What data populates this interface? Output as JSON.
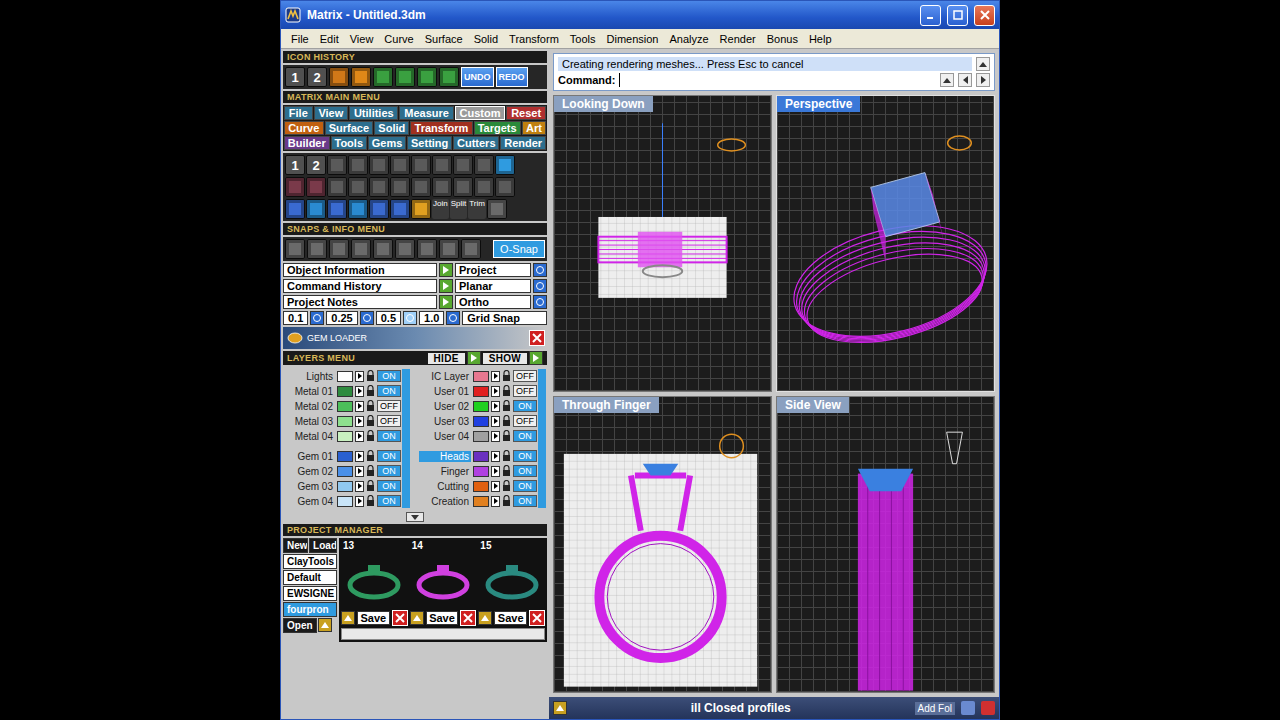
{
  "window": {
    "title": "Matrix - Untitled.3dm"
  },
  "menu_bar": [
    "File",
    "Edit",
    "View",
    "Curve",
    "Surface",
    "Solid",
    "Transform",
    "Tools",
    "Dimension",
    "Analyze",
    "Render",
    "Bonus",
    "Help"
  ],
  "icon_history": {
    "title": "ICON HISTORY",
    "numbers": [
      "1",
      "2"
    ],
    "undo": "UNDO",
    "redo": "REDO"
  },
  "main_menu": {
    "title": "MATRIX MAIN MENU",
    "rows": [
      [
        {
          "label": "File",
          "color": "#2d6e8e",
          "selected": false
        },
        {
          "label": "View",
          "color": "#2d6e8e",
          "selected": false
        },
        {
          "label": "Utilities",
          "color": "#2d6e8e",
          "selected": false
        },
        {
          "label": "Measure",
          "color": "#2d6e8e",
          "selected": false
        },
        {
          "label": "Custom",
          "color": "#2d6e8e",
          "selected": true
        },
        {
          "label": "Reset",
          "color": "#b03030",
          "selected": false
        }
      ],
      [
        {
          "label": "Curve",
          "color": "#c06010",
          "selected": false
        },
        {
          "label": "Surface",
          "color": "#2d6e8e",
          "selected": false
        },
        {
          "label": "Solid",
          "color": "#2d6e8e",
          "selected": false
        },
        {
          "label": "Transform",
          "color": "#a03020",
          "selected": false
        },
        {
          "label": "Targets",
          "color": "#2a8a3a",
          "selected": false
        },
        {
          "label": "Art",
          "color": "#c08010",
          "selected": false
        }
      ],
      [
        {
          "label": "Builder",
          "color": "#6a3a8a",
          "selected": false
        },
        {
          "label": "Tools",
          "color": "#2d6e8e",
          "selected": false
        },
        {
          "label": "Gems",
          "color": "#2d6e8e",
          "selected": false
        },
        {
          "label": "Setting",
          "color": "#2d6e8e",
          "selected": false
        },
        {
          "label": "Cutters",
          "color": "#2d6e8e",
          "selected": false
        },
        {
          "label": "Render",
          "color": "#2d6e8e",
          "selected": false
        }
      ]
    ]
  },
  "tools": {
    "numbers": [
      "1",
      "2"
    ],
    "labels": [
      "Join",
      "Split",
      "Trim"
    ]
  },
  "snaps": {
    "title": "SNAPS & INFO MENU",
    "osnap": "O-Snap",
    "info_rows": [
      {
        "label": "Object Information",
        "toggle": "Project"
      },
      {
        "label": "Command History",
        "toggle": "Planar"
      },
      {
        "label": "Project Notes",
        "toggle": "Ortho"
      }
    ],
    "grid_values": [
      {
        "label": "0.1",
        "selected": false
      },
      {
        "label": "0.25",
        "selected": false
      },
      {
        "label": "0.5",
        "selected": true
      },
      {
        "label": "1.0",
        "selected": false
      }
    ],
    "grid_snap": "Grid Snap"
  },
  "gem_loader": {
    "title": "GEM LOADER"
  },
  "layers": {
    "title": "LAYERS MENU",
    "hide": "HIDE",
    "show": "SHOW",
    "on_text": "ON",
    "off_text": "OFF",
    "columns": [
      [
        [
          {
            "name": "Lights",
            "color": "#ffffff",
            "on": true,
            "selected": false
          },
          {
            "name": "Metal 01",
            "color": "#2e8b3e",
            "on": true,
            "selected": false
          },
          {
            "name": "Metal 02",
            "color": "#4cbf5a",
            "on": false,
            "selected": false
          },
          {
            "name": "Metal 03",
            "color": "#8ee08e",
            "on": false,
            "selected": false
          },
          {
            "name": "Metal 04",
            "color": "#c8f0c0",
            "on": true,
            "selected": false
          }
        ],
        [
          {
            "name": "Gem 01",
            "color": "#2a60d0",
            "on": true,
            "selected": false
          },
          {
            "name": "Gem 02",
            "color": "#4a90e8",
            "on": true,
            "selected": false
          },
          {
            "name": "Gem 03",
            "color": "#90c8f0",
            "on": true,
            "selected": false
          },
          {
            "name": "Gem 04",
            "color": "#c8e4f8",
            "on": true,
            "selected": false
          }
        ]
      ],
      [
        [
          {
            "name": "IC Layer",
            "color": "#e87890",
            "on": false,
            "selected": false
          },
          {
            "name": "User 01",
            "color": "#e02020",
            "on": false,
            "selected": false
          },
          {
            "name": "User 02",
            "color": "#20d020",
            "on": true,
            "selected": false
          },
          {
            "name": "User 03",
            "color": "#2040e0",
            "on": false,
            "selected": false
          },
          {
            "name": "User 04",
            "color": "#a0a0a0",
            "on": true,
            "selected": false
          }
        ],
        [
          {
            "name": "Heads",
            "color": "#6a30c0",
            "on": true,
            "selected": true
          },
          {
            "name": "Finger",
            "color": "#b040e0",
            "on": true,
            "selected": false
          },
          {
            "name": "Cutting",
            "color": "#e06010",
            "on": true,
            "selected": false
          },
          {
            "name": "Creation",
            "color": "#e08020",
            "on": true,
            "selected": false
          }
        ]
      ]
    ]
  },
  "project_manager": {
    "title": "PROJECT MANAGER",
    "new": "New",
    "load": "Load",
    "open": "Open",
    "projects": [
      {
        "label": "ClayTools",
        "selected": false
      },
      {
        "label": "Default",
        "selected": false
      },
      {
        "label": "EWSIGNE",
        "selected": false
      },
      {
        "label": "fourpron",
        "selected": true
      }
    ],
    "thumbnails": [
      {
        "number": "13",
        "save": "Save"
      },
      {
        "number": "14",
        "save": "Save"
      },
      {
        "number": "15",
        "save": "Save"
      }
    ]
  },
  "command": {
    "message": "Creating rendering meshes... Press Esc to cancel",
    "prompt": "Command:"
  },
  "viewports": [
    {
      "label": "Looking Down",
      "selected": false,
      "kind": "top"
    },
    {
      "label": "Perspective",
      "selected": true,
      "kind": "perspective"
    },
    {
      "label": "Through Finger",
      "selected": false,
      "kind": "front"
    },
    {
      "label": "Side View",
      "selected": false,
      "kind": "side"
    }
  ],
  "status_bar": {
    "message": "ill Closed profiles",
    "tray": "Add Fol"
  }
}
